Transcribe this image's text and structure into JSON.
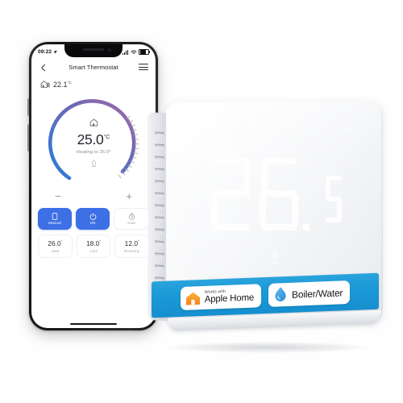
{
  "phone": {
    "status_bar": {
      "time": "09:22",
      "location_icon": "location-arrow-icon",
      "signal_icon": "signal-bars-icon",
      "wifi_icon": "wifi-icon",
      "battery_icon": "battery-icon"
    },
    "nav": {
      "back_icon": "chevron-left-icon",
      "title": "Smart Thermostat",
      "menu_icon": "hamburger-menu-icon"
    },
    "ambient": {
      "icon": "home-sensor-icon",
      "value": "22.1",
      "unit": "°C"
    },
    "dial": {
      "home_icon": "home-icon",
      "temperature": "25.0",
      "unit": "°C",
      "status": "Heating to 26.0°",
      "flame_icon": "heating-flame-icon",
      "decrease_label": "−",
      "increase_label": "+",
      "arc_start_color": "#3f7fd0",
      "arc_end_color": "#8e6fae"
    },
    "modes": [
      {
        "label": "Manual",
        "icon": "document-icon",
        "active": true
      },
      {
        "label": "ON",
        "icon": "power-icon",
        "active": true
      },
      {
        "label": "Auto",
        "icon": "timer-icon",
        "active": false
      }
    ],
    "presets": [
      {
        "value": "26.0",
        "unit": "°",
        "label": "Heat"
      },
      {
        "value": "18.0",
        "unit": "°",
        "label": "Cool"
      },
      {
        "value": "12.0",
        "unit": "°",
        "label": "Economy"
      }
    ],
    "home_indicator": "home-indicator-bar"
  },
  "thermostat": {
    "status_icons": [
      "wifi-icon",
      "timer-icon",
      "heating-sun-icon",
      "fan-air-icon",
      "water-drop-icon",
      "schedule-calendar-icon"
    ],
    "display": {
      "value": "26",
      "decimal": ".",
      "fraction": "5"
    },
    "heating_indicator_icon": "heating-flame-icon",
    "banner": {
      "color": "#1b9ad7",
      "badges": [
        {
          "icon": "apple-home-house-icon",
          "small_text": "Works with",
          "big_text": "Apple Home"
        },
        {
          "icon": "water-drop-icon",
          "big_text": "Boiler/Water"
        }
      ]
    },
    "vent_count": 14
  }
}
